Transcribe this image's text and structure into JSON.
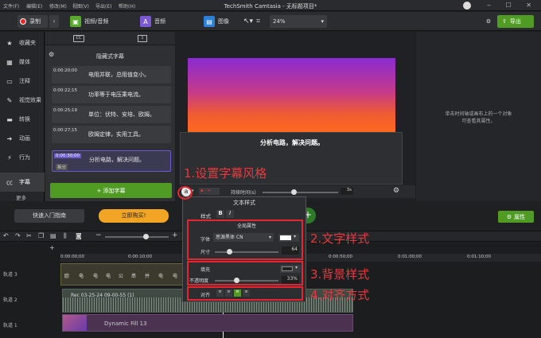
{
  "menu": [
    "文件(F)",
    "编辑(E)",
    "修改(M)",
    "视图(V)",
    "导出(E)",
    "帮助(H)"
  ],
  "window_title": "TechSmith Camtasia - 无标题项目*",
  "toolbar": {
    "record_label": "录制",
    "media_tabs": [
      "视频/音频",
      "音频",
      "图像"
    ],
    "zoom": "24%",
    "export_label": "导出"
  },
  "sidebar": {
    "items": [
      "收藏夹",
      "媒体",
      "注释",
      "视觉效果",
      "转换",
      "动画",
      "行为",
      "字幕"
    ],
    "more": "更多"
  },
  "captions": {
    "header": "隐藏式字幕",
    "rows": [
      {
        "time": "0:00:20;00",
        "text": "电阻并联，总阻值变小。"
      },
      {
        "time": "0:00:22;15",
        "text": "功率等于电压乘电流。"
      },
      {
        "time": "0:00:25;19",
        "text": "单位：伏特、安培、欧姆。"
      },
      {
        "time": "0:00:27;15",
        "text": "欧姆定律，实用工具。"
      },
      {
        "time": "0:00:30;00",
        "text": "分析电路，解决问题。"
      }
    ],
    "split_label": "拆分",
    "add_label": "+ 添加字幕"
  },
  "canvas": {
    "caption_text": "分析电路，解决问题。",
    "duration_label": "持续时间(s)",
    "duration_value": "3s"
  },
  "properties": {
    "hint_line1": "单击时间轴或画布上的一个对象",
    "hint_line2": "可查看其属性。",
    "button_label": "属性"
  },
  "promo": {
    "guide_label": "快速入门指南",
    "buy_label": "立即购买!"
  },
  "popup": {
    "title": "文本样式",
    "style_label": "样式",
    "bold": "B",
    "italic": "I",
    "global_header": "全局属性",
    "font_label": "字体",
    "font_value": "思源黑体 CN",
    "size_label": "尺寸",
    "size_value": "64",
    "fill_label": "填充",
    "opacity_label": "不透明度",
    "opacity_value": "33%",
    "align_label": "对齐"
  },
  "annotations": {
    "a1": "1.设置字幕风格",
    "a2": "2.文字样式",
    "a3": "3.背景样式",
    "a4": "4.对齐方式"
  },
  "timeline": {
    "times": [
      "0:00:00;00",
      "0:00:10;00",
      "0:00:50;00",
      "0:01:00;00",
      "0:01:10;00"
    ],
    "tracks": [
      "轨道 3",
      "轨道 2",
      "轨道 1"
    ],
    "track3_chars": [
      "欧",
      "电",
      "电",
      "电",
      "公",
      "串",
      "并",
      "电",
      "电"
    ],
    "track2_clip": "Rec 03-25-24 09-00-55 (1)",
    "track1_clip": "Dynamic Fill 13"
  },
  "colors": {
    "accent_green": "#4f9b24",
    "annotation_red": "#e3262f",
    "buy_orange": "#f2a524"
  }
}
